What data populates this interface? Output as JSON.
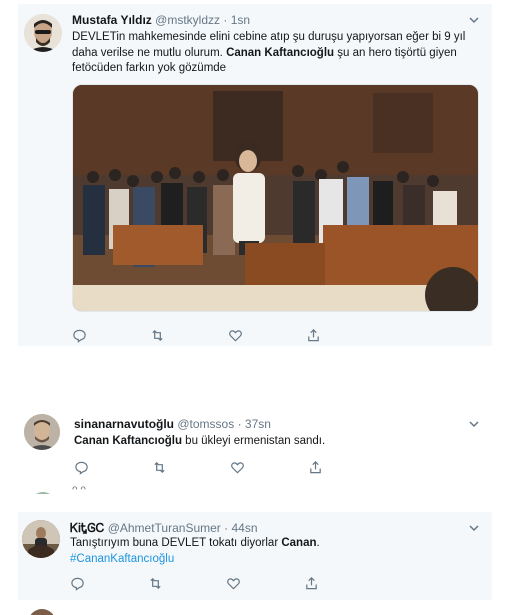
{
  "tweets": [
    {
      "display_name": "Mustafa Yıldız",
      "handle": "@mstkyldzz",
      "separator": "·",
      "time": "1sn",
      "text": {
        "p1": "DEVLET",
        "p2": "in mahkemesinde elini cebine atıp şu duruşu yapıyorsan eğer bi 9 yıl daha verilse ne mutlu olurum. ",
        "p3": "Canan Kaftancıoğlu",
        "p4": " şu an hero tişörtü giyen fetöcüden farkın yok gözümde"
      }
    },
    {
      "display_name": "sinanarnavutoğlu",
      "handle": "@tomssos",
      "separator": "·",
      "time": "37sn",
      "text": {
        "p1": "Canan Kaftancıoğlu",
        "p2": " bu ükleyi ermenistan sandı."
      }
    },
    {
      "display_name": "ᏦᎥᎿᎶᏟ",
      "handle": "@AhmetTuranSumer",
      "separator": "·",
      "time": "44sn",
      "text": {
        "p1": "Tanıştırıyım buna DEVLET tokatı diyorlar ",
        "p2": "Canan",
        "p3": ".",
        "hashtag": "#CananKaftancıoğlu"
      }
    }
  ],
  "separator_fragment": "ᴖ ᴖ",
  "icons": {
    "reply": "reply-icon",
    "retweet": "retweet-icon",
    "like": "heart-icon",
    "share": "share-icon",
    "caret": "chevron-down-icon"
  },
  "colors": {
    "link": "#1b95e0",
    "muted": "#657786",
    "highlight_bg": "#f5f8fa"
  }
}
